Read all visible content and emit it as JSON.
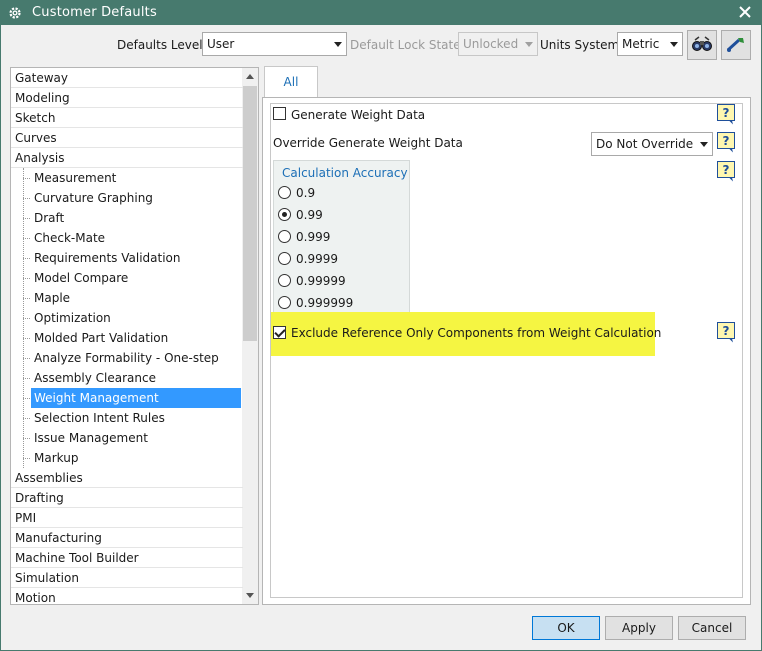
{
  "window": {
    "title": "Customer Defaults",
    "accent": "#477a6e"
  },
  "toolbar": {
    "defaults_level_label": "Defaults Level",
    "defaults_level_value": "User",
    "lock_state_label": "Default Lock State",
    "lock_state_value": "Unlocked",
    "units_label": "Units System",
    "units_value": "Metric"
  },
  "tree": {
    "items": [
      {
        "label": "Gateway"
      },
      {
        "label": "Modeling"
      },
      {
        "label": "Sketch"
      },
      {
        "label": "Curves"
      },
      {
        "label": "Analysis"
      },
      {
        "label": "Measurement"
      },
      {
        "label": "Curvature Graphing"
      },
      {
        "label": "Draft"
      },
      {
        "label": "Check-Mate"
      },
      {
        "label": "Requirements Validation"
      },
      {
        "label": "Model Compare"
      },
      {
        "label": "Maple"
      },
      {
        "label": "Optimization"
      },
      {
        "label": "Molded Part Validation"
      },
      {
        "label": "Analyze Formability - One-step"
      },
      {
        "label": "Assembly Clearance"
      },
      {
        "label": "Weight Management"
      },
      {
        "label": "Selection Intent Rules"
      },
      {
        "label": "Issue Management"
      },
      {
        "label": "Markup"
      },
      {
        "label": "Assemblies"
      },
      {
        "label": "Drafting"
      },
      {
        "label": "PMI"
      },
      {
        "label": "Manufacturing"
      },
      {
        "label": "Machine Tool Builder"
      },
      {
        "label": "Simulation"
      },
      {
        "label": "Motion"
      }
    ],
    "selected": "Weight Management",
    "selection_color": "#3399ff"
  },
  "tabs": [
    {
      "label": "All"
    }
  ],
  "settings": {
    "generate_weight_label": "Generate Weight Data",
    "generate_weight_checked": false,
    "override_label": "Override Generate Weight Data",
    "override_value": "Do Not Override",
    "accuracy_title": "Calculation Accuracy",
    "accuracy_options": [
      "0.9",
      "0.99",
      "0.999",
      "0.9999",
      "0.99999",
      "0.999999"
    ],
    "accuracy_selected": "0.99",
    "exclude_label": "Exclude Reference Only Components from Weight Calculation",
    "exclude_checked": true,
    "highlight_color": "#f5f542"
  },
  "buttons": {
    "ok": "OK",
    "apply": "Apply",
    "cancel": "Cancel"
  }
}
